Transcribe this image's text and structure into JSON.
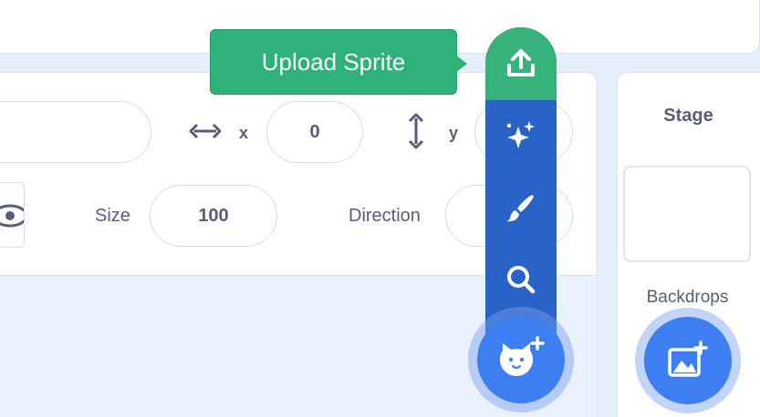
{
  "tooltip": {
    "text": "Upload Sprite"
  },
  "sprite_info": {
    "x_label": "x",
    "x_value": "0",
    "y_label": "y",
    "size_label": "Size",
    "size_value": "100",
    "direction_label": "Direction"
  },
  "sprite_menu": {
    "items": [
      {
        "icon": "upload-icon"
      },
      {
        "icon": "sparkles-icon"
      },
      {
        "icon": "paintbrush-icon"
      },
      {
        "icon": "search-icon"
      }
    ],
    "main_button_icon": "cat-plus-icon"
  },
  "stage_pane": {
    "title": "Stage",
    "backdrops_label": "Backdrops",
    "backdrop_button_icon": "image-plus-icon"
  },
  "colors": {
    "upload_green": "#38b27b",
    "menu_blue": "#2a63c8",
    "button_blue": "#3d7ef2",
    "text_gray": "#575e75",
    "background": "#e5effc"
  }
}
